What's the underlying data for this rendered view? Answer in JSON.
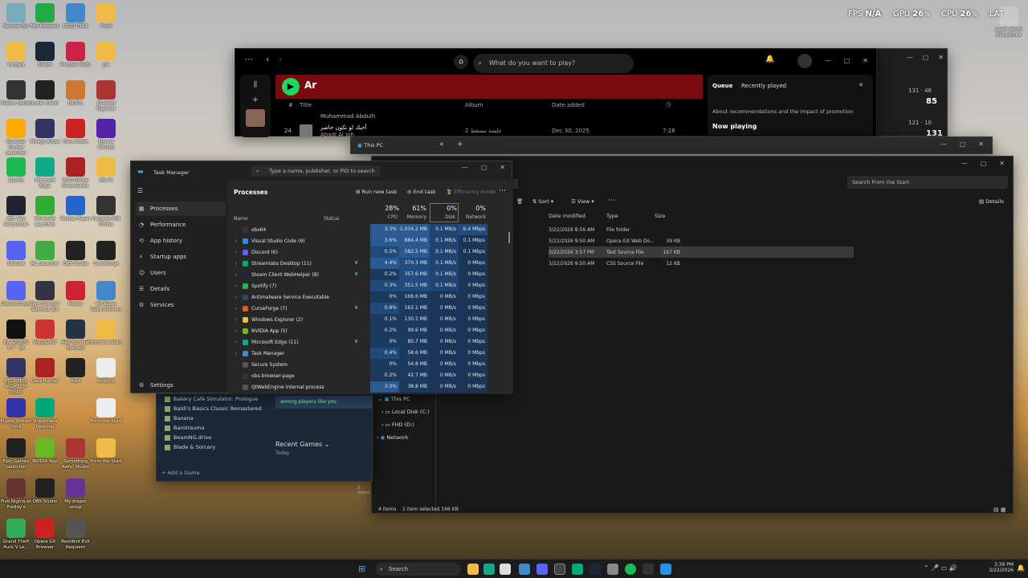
{
  "overlay": {
    "fps_label": "FPS",
    "fps_val": "N/A",
    "gpu_label": "GPU",
    "gpu_val": "26",
    "cpu_label": "CPU",
    "cpu_val": "26",
    "lat_label": "LAT"
  },
  "desktop_icons": [
    {
      "label": "Recycle Bin",
      "color": "#7ab"
    },
    {
      "label": "Mio Webcam",
      "color": "#2a4"
    },
    {
      "label": "PS2D P5RX",
      "color": "#48c"
    },
    {
      "label": "Proof",
      "color": "#eb4"
    },
    {
      "label": "mr.gark",
      "color": "#eb4"
    },
    {
      "label": "Steam",
      "color": "#1b2838"
    },
    {
      "label": "Purpose Party",
      "color": "#c24"
    },
    {
      "label": "pw",
      "color": "#eb4"
    },
    {
      "label": "Roblox Studio",
      "color": "#333"
    },
    {
      "label": "Lunar Client",
      "color": "#222"
    },
    {
      "label": "ISLPCL",
      "color": "#c73"
    },
    {
      "label": "Chained Together",
      "color": "#a33"
    },
    {
      "label": "Rockstar Games Launcher",
      "color": "#fa0"
    },
    {
      "label": "Mirage Arena",
      "color": "#336"
    },
    {
      "label": "Hero Client",
      "color": "#c22"
    },
    {
      "label": "Marvel (Rivals)",
      "color": "#52a"
    },
    {
      "label": "Spotify",
      "color": "#1db954"
    },
    {
      "label": "Microsoft Edge",
      "color": "#1a8"
    },
    {
      "label": "ROG Global Downloader",
      "color": "#a22"
    },
    {
      "label": "Afk-Pc",
      "color": "#eb4"
    },
    {
      "label": "ABC Neo Autoclicker",
      "color": "#223"
    },
    {
      "label": "Minecraft Launcher",
      "color": "#3a3"
    },
    {
      "label": "Roblox Player",
      "color": "#26c"
    },
    {
      "label": "Pangolet Rift Online",
      "color": "#333"
    },
    {
      "label": "Discord",
      "color": "#5865f2"
    },
    {
      "label": "ML Launcher",
      "color": "#4a4"
    },
    {
      "label": "OBS Studio",
      "color": "#222"
    },
    {
      "label": "CurseForge",
      "color": "#222"
    },
    {
      "label": "Discord Copy",
      "color": "#5865f2"
    },
    {
      "label": "Tom Clancy's Rainbow Six",
      "color": "#334"
    },
    {
      "label": "Parsec",
      "color": "#c23"
    },
    {
      "label": "Wii Wave Pizza Delivery",
      "color": "#48c"
    },
    {
      "label": "EA SPORTS FC™ 26",
      "color": "#111"
    },
    {
      "label": "VALORANT",
      "color": "#c33"
    },
    {
      "label": "ARK Survival Evolved",
      "color": "#234"
    },
    {
      "label": "From the Start",
      "color": "#eb4"
    },
    {
      "label": "ECLIPSED: NIGHT OF DEAD",
      "color": "#336"
    },
    {
      "label": "Cass Hoover",
      "color": "#a22"
    },
    {
      "label": "Rast",
      "color": "#222"
    },
    {
      "label": "script.js",
      "color": "#eee"
    },
    {
      "label": "Elgato Stream Deck",
      "color": "#33a"
    },
    {
      "label": "Streamlabs Desktop",
      "color": "#0a7"
    },
    {
      "label": "",
      "color": "transparent"
    },
    {
      "label": "From the Start",
      "color": "#eee"
    },
    {
      "label": "Epic Games Launcher",
      "color": "#222"
    },
    {
      "label": "NVIDIA App",
      "color": "#6b2"
    },
    {
      "label": "Something Awful Studio",
      "color": "#a33"
    },
    {
      "label": "From the Start",
      "color": "#eb4"
    },
    {
      "label": "Five Nights at Freddy's",
      "color": "#633"
    },
    {
      "label": "OBS Studio",
      "color": "#222"
    },
    {
      "label": "My dream setup",
      "color": "#639"
    },
    {
      "label": "",
      "color": "transparent"
    },
    {
      "label": "Grand Theft Auto V Le...",
      "color": "#3a5"
    },
    {
      "label": "Opera GX Browser",
      "color": "#c22"
    },
    {
      "label": "Resident Evil Requiem",
      "color": "#555"
    },
    {
      "label": "",
      "color": "transparent"
    }
  ],
  "right_icon": {
    "label": "Learn about this picture"
  },
  "spotify": {
    "search_placeholder": "What do you want to play?",
    "playlist_title": "Ar",
    "col_hash": "#",
    "col_title": "Title",
    "col_album": "Album",
    "col_date": "Date added",
    "row1_artist": "Muhammad Abdulh",
    "row2_num": "24",
    "row2_title": "أحبك لو تكون حاضر",
    "row2_artist": "Abadi Al Joh",
    "row2_album": "2 جلسة مسقط",
    "row2_date": "Dec 30, 2025",
    "row2_time": "7:28",
    "queue_tab": "Queue",
    "recent_tab": "Recently played",
    "queue_note": "About recommendations and the impact of promotion",
    "now_playing": "Now playing"
  },
  "bgwin": {
    "n1": "131",
    "n2": "46",
    "big1": "85",
    "n3": "121",
    "n4": "10",
    "big2": "131"
  },
  "explorer": {
    "tab_title": "This PC",
    "search_placeholder": "Search From the Start",
    "sort": "Sort",
    "view": "View",
    "details": "Details",
    "col_modified": "Date modified",
    "col_type": "Type",
    "col_size": "Size",
    "rows": [
      {
        "date": "3/22/2026 8:56 AM",
        "type": "File folder",
        "size": ""
      },
      {
        "date": "3/22/2026 9:50 AM",
        "type": "Opera GX Web Do...",
        "size": "39 KB"
      },
      {
        "date": "3/22/2026 3:57 PM",
        "type": "Text Source File",
        "size": "167 KB"
      },
      {
        "date": "3/22/2026 9:50 AM",
        "type": "CSS Source File",
        "size": "12 KB"
      }
    ],
    "tree": [
      {
        "label": "This PC"
      },
      {
        "label": "Local Disk (C:)"
      },
      {
        "label": "FHD (D:)"
      },
      {
        "label": "Network"
      }
    ],
    "status": "4 items",
    "selected": "1 item selected  166 KB",
    "steam_items": "2 items"
  },
  "taskmanager": {
    "title": "Task Manager",
    "search_placeholder": "Type a name, publisher, or PID to search",
    "nav": [
      {
        "label": "Processes",
        "icon": "▦"
      },
      {
        "label": "Performance",
        "icon": "◔"
      },
      {
        "label": "App history",
        "icon": "⟲"
      },
      {
        "label": "Startup apps",
        "icon": "⚡"
      },
      {
        "label": "Users",
        "icon": "☺"
      },
      {
        "label": "Details",
        "icon": "☰"
      },
      {
        "label": "Services",
        "icon": "⚙"
      }
    ],
    "settings": "Settings",
    "heading": "Processes",
    "run_new_task": "Run new task",
    "end_task": "End task",
    "efficiency": "Efficiency mode",
    "col_name": "Name",
    "col_status": "Status",
    "cpu_pct": "28%",
    "cpu_lbl": "CPU",
    "mem_pct": "61%",
    "mem_lbl": "Memory",
    "disk_pct": "0%",
    "disk_lbl": "Disk",
    "net_pct": "0%",
    "net_lbl": "Network",
    "processes": [
      {
        "name": "obs64",
        "cpu": "3.3%",
        "mem": "1,034.2 MB",
        "disk": "0.1 MB/s",
        "net": "6.4 Mbps",
        "exp": false,
        "color": "#333",
        "eco": false
      },
      {
        "name": "Visual Studio Code (9)",
        "cpu": "3.6%",
        "mem": "884.4 MB",
        "disk": "0.1 MB/s",
        "net": "0.1 Mbps",
        "exp": true,
        "color": "#2a8ee8",
        "eco": false
      },
      {
        "name": "Discord (6)",
        "cpu": "0.5%",
        "mem": "582.5 MB",
        "disk": "0.1 MB/s",
        "net": "0.1 Mbps",
        "exp": true,
        "color": "#5865f2",
        "eco": false
      },
      {
        "name": "Streamlabs Desktop (11)",
        "cpu": "4.4%",
        "mem": "370.3 MB",
        "disk": "0.1 MB/s",
        "net": "0 Mbps",
        "exp": true,
        "color": "#0a7",
        "eco": true
      },
      {
        "name": "Steam Client WebHelper (8)",
        "cpu": "0.2%",
        "mem": "357.6 MB",
        "disk": "0.1 MB/s",
        "net": "0 Mbps",
        "exp": true,
        "color": "#1b2838",
        "eco": true
      },
      {
        "name": "Spotify (7)",
        "cpu": "0.3%",
        "mem": "351.5 MB",
        "disk": "0.1 MB/s",
        "net": "0 Mbps",
        "exp": true,
        "color": "#1db954",
        "eco": false
      },
      {
        "name": "Antimalware Service Executable",
        "cpu": "0%",
        "mem": "168.6 MB",
        "disk": "0 MB/s",
        "net": "0 Mbps",
        "exp": true,
        "color": "#346",
        "eco": false
      },
      {
        "name": "CurseForge (7)",
        "cpu": "0.8%",
        "mem": "162.1 MB",
        "disk": "0 MB/s",
        "net": "0 Mbps",
        "exp": true,
        "color": "#e8591a",
        "eco": true
      },
      {
        "name": "Windows Explorer (2)",
        "cpu": "0.1%",
        "mem": "130.1 MB",
        "disk": "0 MB/s",
        "net": "0 Mbps",
        "exp": true,
        "color": "#eb4",
        "eco": false
      },
      {
        "name": "NVIDIA App (5)",
        "cpu": "0.2%",
        "mem": "99.6 MB",
        "disk": "0 MB/s",
        "net": "0 Mbps",
        "exp": true,
        "color": "#76b900",
        "eco": false
      },
      {
        "name": "Microsoft Edge (11)",
        "cpu": "0%",
        "mem": "80.7 MB",
        "disk": "0 MB/s",
        "net": "0 Mbps",
        "exp": true,
        "color": "#1a8",
        "eco": true
      },
      {
        "name": "Task Manager",
        "cpu": "0.4%",
        "mem": "58.6 MB",
        "disk": "0 MB/s",
        "net": "0 Mbps",
        "exp": true,
        "color": "#48c",
        "eco": false
      },
      {
        "name": "Secure System",
        "cpu": "0%",
        "mem": "54.8 MB",
        "disk": "0 MB/s",
        "net": "0 Mbps",
        "exp": false,
        "color": "#555",
        "eco": false
      },
      {
        "name": "obs-browser-page",
        "cpu": "0.2%",
        "mem": "42.7 MB",
        "disk": "0 MB/s",
        "net": "0 Mbps",
        "exp": false,
        "color": "#333",
        "eco": false
      },
      {
        "name": "QtWebEngine internal process",
        "cpu": "3.0%",
        "mem": "38.8 MB",
        "disk": "0 MB/s",
        "net": "0 Mbps",
        "exp": false,
        "color": "#555",
        "eco": false
      }
    ]
  },
  "steam": {
    "games": [
      "Bakery Cafe Simulator: Prologue",
      "Baldi's Basics Classic Remastered",
      "Banana",
      "Barotrauma",
      "BeamNG.drive",
      "Blade & Sorcery"
    ],
    "add_game": "Add a Game",
    "recent": "Recent Games",
    "today": "Today",
    "players": "among players like you"
  },
  "taskbar": {
    "search": "Search",
    "time": "3:39 PM",
    "date": "3/22/2026"
  }
}
